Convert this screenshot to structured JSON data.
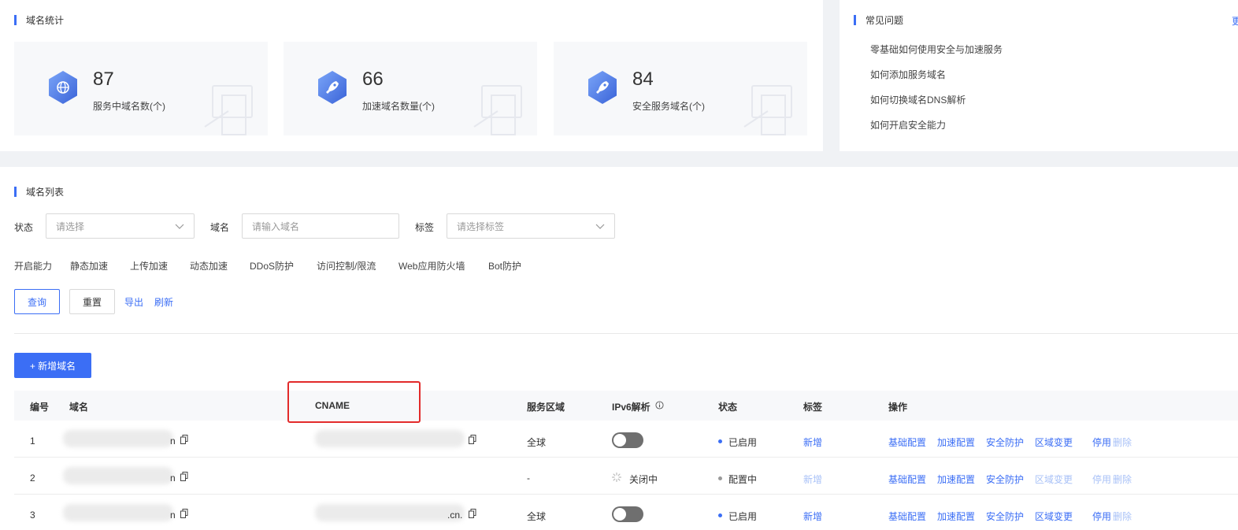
{
  "stats": {
    "title": "域名统计",
    "cards": [
      {
        "value": "87",
        "label": "服务中域名数(个)",
        "icon": "globe-icon"
      },
      {
        "value": "66",
        "label": "加速域名数量(个)",
        "icon": "rocket-icon"
      },
      {
        "value": "84",
        "label": "安全服务域名(个)",
        "icon": "rocket-icon"
      }
    ]
  },
  "faq": {
    "title": "常见问题",
    "more": "更",
    "items": [
      "零基础如何使用安全与加速服务",
      "如何添加服务域名",
      "如何切换域名DNS解析",
      "如何开启安全能力"
    ]
  },
  "list": {
    "title": "域名列表",
    "filters": {
      "status_label": "状态",
      "status_placeholder": "请选择",
      "domain_label": "域名",
      "domain_placeholder": "请输入域名",
      "tag_label": "标签",
      "tag_placeholder": "请选择标签"
    },
    "abilities_label": "开启能力",
    "abilities": [
      "静态加速",
      "上传加速",
      "动态加速",
      "DDoS防护",
      "访问控制/限流",
      "Web应用防火墙",
      "Bot防护"
    ],
    "buttons": {
      "query": "查询",
      "reset": "重置",
      "export": "导出",
      "refresh": "刷新",
      "add": "+ 新增域名"
    },
    "columns": [
      "编号",
      "域名",
      "CNAME",
      "服务区域",
      "IPv6解析",
      "状态",
      "标签",
      "操作"
    ],
    "rows": [
      {
        "id": "1",
        "domain_suffix": "n",
        "cname_suffix": "",
        "region": "全球",
        "ipv6": "toggle-off",
        "status": "已启用",
        "status_color": "#3b6ef5",
        "tag": "新增",
        "tag_disabled": false,
        "ops": [
          {
            "label": "基础配置",
            "disabled": false
          },
          {
            "label": "加速配置",
            "disabled": false
          },
          {
            "label": "安全防护",
            "disabled": false
          },
          {
            "label": "区域变更",
            "disabled": false
          },
          {
            "label": "停用",
            "disabled": false
          },
          {
            "label": "删除",
            "disabled": true
          }
        ]
      },
      {
        "id": "2",
        "domain_suffix": "n",
        "cname_suffix": "",
        "region": "-",
        "ipv6": "关闭中",
        "status": "配置中",
        "status_color": "#999999",
        "tag": "新增",
        "tag_disabled": true,
        "ops": [
          {
            "label": "基础配置",
            "disabled": false
          },
          {
            "label": "加速配置",
            "disabled": false
          },
          {
            "label": "安全防护",
            "disabled": false
          },
          {
            "label": "区域变更",
            "disabled": true
          },
          {
            "label": "停用",
            "disabled": true
          },
          {
            "label": "删除",
            "disabled": true
          }
        ]
      },
      {
        "id": "3",
        "domain_suffix": "n",
        "cname_suffix": ".cn.",
        "region": "全球",
        "ipv6": "toggle-off",
        "status": "已启用",
        "status_color": "#3b6ef5",
        "tag": "新增",
        "tag_disabled": false,
        "ops": [
          {
            "label": "基础配置",
            "disabled": false
          },
          {
            "label": "加速配置",
            "disabled": false
          },
          {
            "label": "安全防护",
            "disabled": false
          },
          {
            "label": "区域变更",
            "disabled": false
          },
          {
            "label": "停用",
            "disabled": false
          },
          {
            "label": "删除",
            "disabled": true
          }
        ]
      }
    ]
  }
}
